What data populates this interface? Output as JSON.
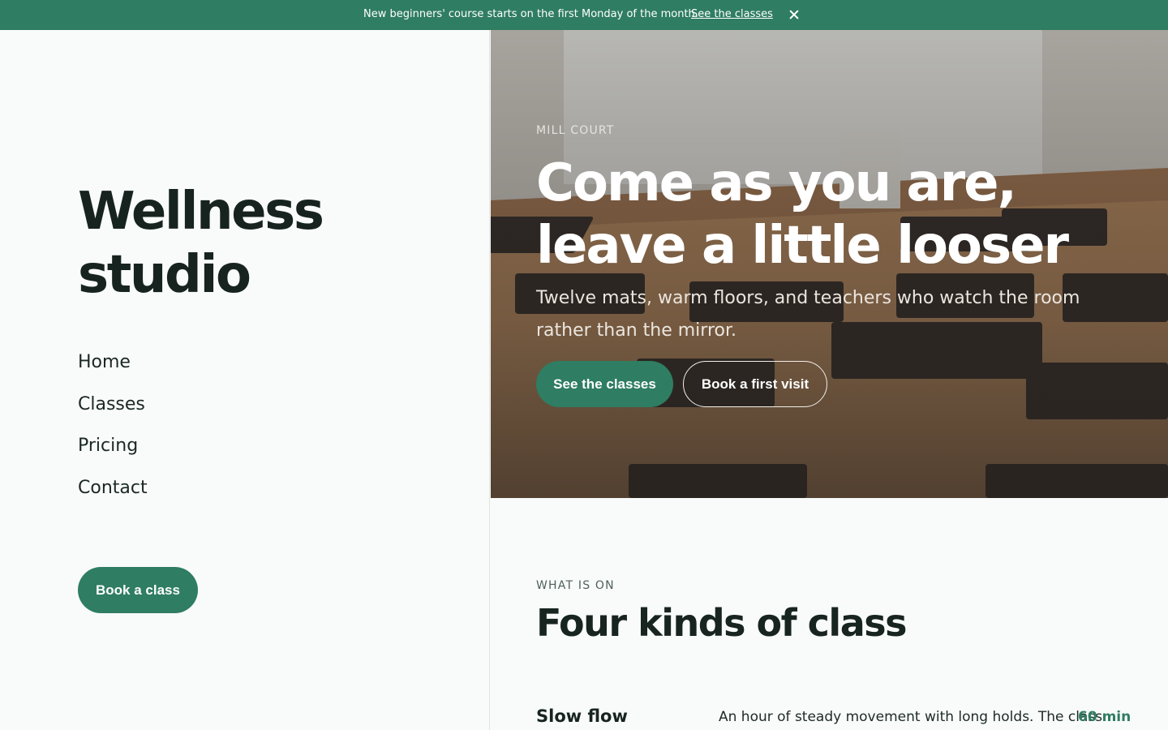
{
  "banner": {
    "message": "New beginners' course starts on the first Monday of the month.",
    "link_label": "See the classes",
    "close_icon": "close-icon"
  },
  "sidebar": {
    "brand": "Wellness studio",
    "nav": [
      "Home",
      "Classes",
      "Pricing",
      "Contact"
    ],
    "book_button": "Book a class"
  },
  "hero": {
    "eyebrow": "MILL COURT",
    "title": "Come as you are, leave a little looser",
    "subtitle": "Twelve mats, warm floors, and teachers who watch the room rather than the mirror.",
    "primary_button": "See the classes",
    "secondary_button": "Book a first visit",
    "image": "yoga-studio-photo"
  },
  "classes": {
    "eyebrow": "WHAT IS ON",
    "title": "Four kinds of class",
    "items": [
      {
        "name": "Slow flow",
        "description": "An hour of steady movement with long holds. The class",
        "duration": "60 min"
      }
    ]
  },
  "colors": {
    "accent": "#2f7d62",
    "background": "#f8fbfa",
    "text": "#18241f"
  }
}
